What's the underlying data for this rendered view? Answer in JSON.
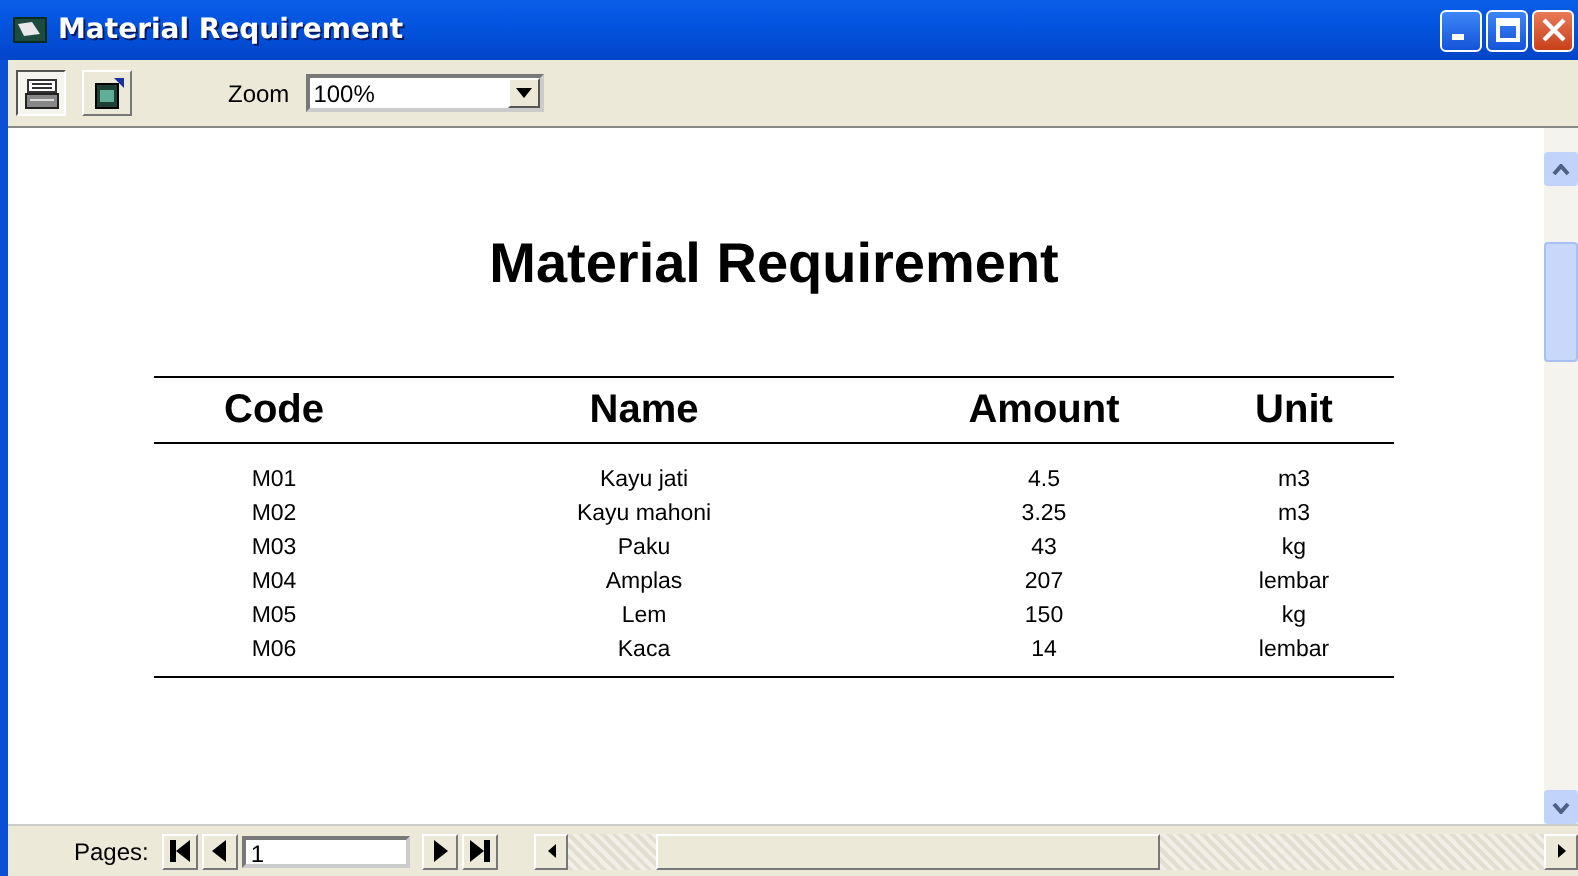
{
  "window": {
    "title": "Material Requirement"
  },
  "toolbar": {
    "zoom_label": "Zoom",
    "zoom_value": "100%"
  },
  "report": {
    "title": "Material Requirement",
    "columns": [
      "Code",
      "Name",
      "Amount",
      "Unit"
    ],
    "rows": [
      [
        "M01",
        "Kayu jati",
        "4.5",
        "m3"
      ],
      [
        "M02",
        "Kayu mahoni",
        "3.25",
        "m3"
      ],
      [
        "M03",
        "Paku",
        "43",
        "kg"
      ],
      [
        "M04",
        "Amplas",
        "207",
        "lembar"
      ],
      [
        "M05",
        "Lem",
        "150",
        "kg"
      ],
      [
        "M06",
        "Kaca",
        "14",
        "lembar"
      ]
    ]
  },
  "status_bar": {
    "pages_label": "Pages:",
    "page_value": "1"
  }
}
